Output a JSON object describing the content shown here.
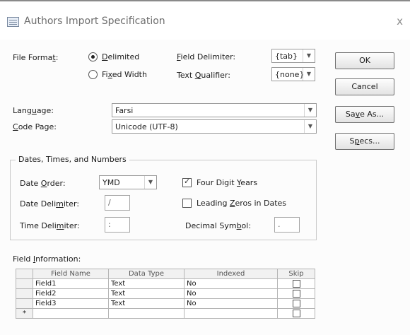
{
  "window": {
    "title": "Authors Import Specification",
    "close_glyph": "x"
  },
  "file_format": {
    "label": "File Format:",
    "delimited": {
      "label": "Delimited",
      "checked": true
    },
    "fixed_width": {
      "label": "Fixed Width",
      "checked": false
    }
  },
  "field_delimiter": {
    "label": "Field Delimiter:",
    "value": "{tab}"
  },
  "text_qualifier": {
    "label": "Text Qualifier:",
    "value": "{none}"
  },
  "language": {
    "label": "Language:",
    "value": "Farsi"
  },
  "code_page": {
    "label": "Code Page:",
    "value": "Unicode (UTF-8)"
  },
  "buttons": {
    "ok": "OK",
    "cancel": "Cancel",
    "save_as": "Save As...",
    "specs": "Specs..."
  },
  "dates": {
    "group_title": "Dates, Times, and Numbers",
    "date_order": {
      "label": "Date Order:",
      "value": "YMD"
    },
    "date_delimiter": {
      "label": "Date Delimiter:",
      "value": "/"
    },
    "time_delimiter": {
      "label": "Time Delimiter:",
      "value": ":"
    },
    "four_digit_years": {
      "label": "Four Digit Years",
      "checked": true
    },
    "leading_zeros": {
      "label": "Leading Zeros in Dates",
      "checked": false
    },
    "decimal_symbol": {
      "label": "Decimal Symbol:",
      "value": "."
    }
  },
  "field_info": {
    "label": "Field Information:",
    "columns": [
      "Field Name",
      "Data Type",
      "Indexed",
      "Skip"
    ],
    "rows": [
      {
        "name": "Field1",
        "type": "Text",
        "indexed": "No",
        "skip": false
      },
      {
        "name": "Field2",
        "type": "Text",
        "indexed": "No",
        "skip": false
      },
      {
        "name": "Field3",
        "type": "Text",
        "indexed": "No",
        "skip": false
      }
    ],
    "new_row_marker": "*"
  }
}
